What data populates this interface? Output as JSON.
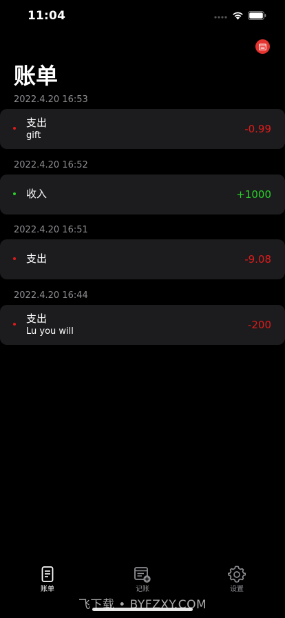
{
  "status_bar": {
    "time": "11:04"
  },
  "page": {
    "title": "账单"
  },
  "colors": {
    "expense": "#e01b1b",
    "income": "#2ad12a",
    "accent": "#e5342f",
    "card": "#1c1c1e"
  },
  "records": [
    {
      "time": "2022.4.20 16:53",
      "type": "支出",
      "note": "gift",
      "amount": "-0.99",
      "kind": "expense"
    },
    {
      "time": "2022.4.20 16:52",
      "type": "收入",
      "note": "",
      "amount": "+1000",
      "kind": "income"
    },
    {
      "time": "2022.4.20 16:51",
      "type": "支出",
      "note": "",
      "amount": "-9.08",
      "kind": "expense"
    },
    {
      "time": "2022.4.20 16:44",
      "type": "支出",
      "note": "Lu you will",
      "amount": "-200",
      "kind": "expense"
    }
  ],
  "tabs": [
    {
      "label": "账单",
      "icon": "document-icon",
      "active": true
    },
    {
      "label": "记账",
      "icon": "add-record-icon",
      "active": false
    },
    {
      "label": "设置",
      "icon": "gear-icon",
      "active": false
    }
  ],
  "watermark": "飞下载 • BYFZXY.COM"
}
